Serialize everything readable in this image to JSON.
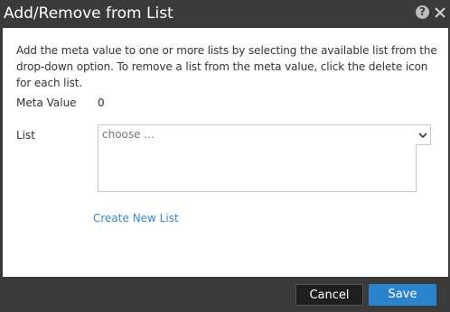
{
  "dialog": {
    "title": "Add/Remove from List",
    "help_icon": "question-mark",
    "close_icon": "close"
  },
  "content": {
    "description": "Add the meta value to one or more lists by selecting the available list from the drop-down option. To remove a list from the meta value, click the delete icon for each list.",
    "meta_value_label": "Meta Value",
    "meta_value": "0",
    "list_label": "List",
    "list_select_placeholder": "choose ...",
    "create_new_list_link": "Create New List"
  },
  "footer": {
    "cancel_label": "Cancel",
    "save_label": "Save"
  },
  "colors": {
    "titlebar_bg": "#3a3a3a",
    "link": "#3b87c6",
    "save_button": "#2b83cc",
    "cancel_button": "#1f1f1f"
  }
}
